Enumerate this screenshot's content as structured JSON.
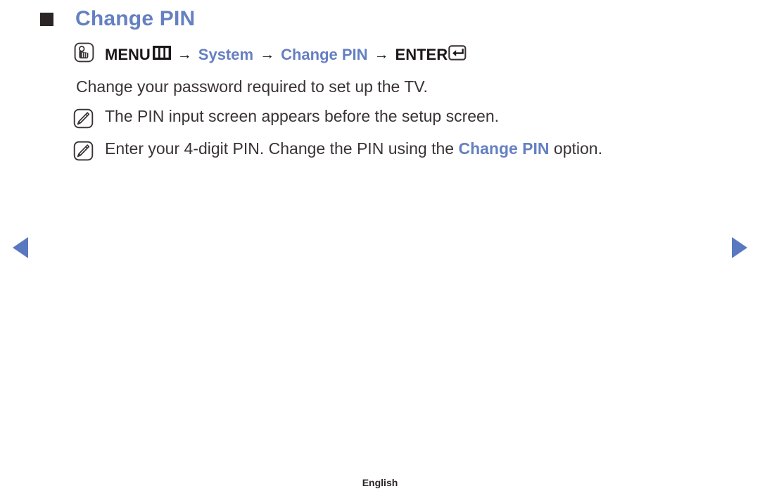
{
  "page": {
    "title": "Change PIN",
    "bullet_icon": "black-square-bullet",
    "accent_color": "#6580c2",
    "text_color": "#3a3336"
  },
  "menu_path": {
    "hand_icon": "hand-press-icon",
    "menu_label": "MENU",
    "menu_icon": "menu-bars-icon",
    "separator": "→",
    "step_system": "System",
    "step_change_pin": "Change PIN",
    "enter_label": "ENTER",
    "enter_icon": "enter-return-icon"
  },
  "description": "Change your password required to set up the TV.",
  "notes": [
    {
      "icon": "note-pen-icon",
      "text_before": "The PIN input screen appears before the setup screen.",
      "highlight": "",
      "text_after": ""
    },
    {
      "icon": "note-pen-icon",
      "text_before": "Enter your 4-digit PIN. Change the PIN using the ",
      "highlight": "Change PIN",
      "text_after": " option."
    }
  ],
  "navigation": {
    "prev_icon": "previous-page-arrow",
    "next_icon": "next-page-arrow"
  },
  "footer": {
    "language": "English"
  }
}
